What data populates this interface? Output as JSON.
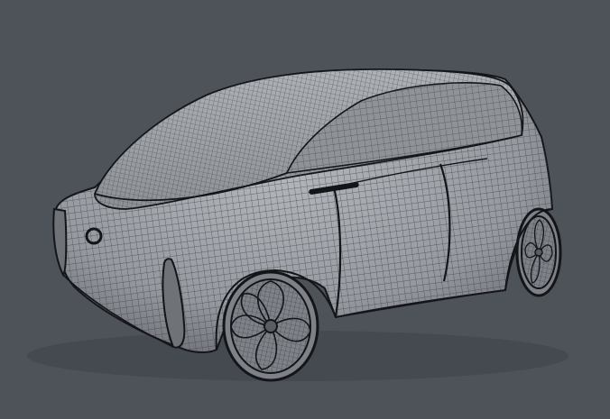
{
  "scene": {
    "subject": "wireframe-car-model",
    "background_color": "#4d5359",
    "body_color": "#9a9ea4",
    "wire_color": "#3a3d42",
    "outline_color": "#141518"
  }
}
